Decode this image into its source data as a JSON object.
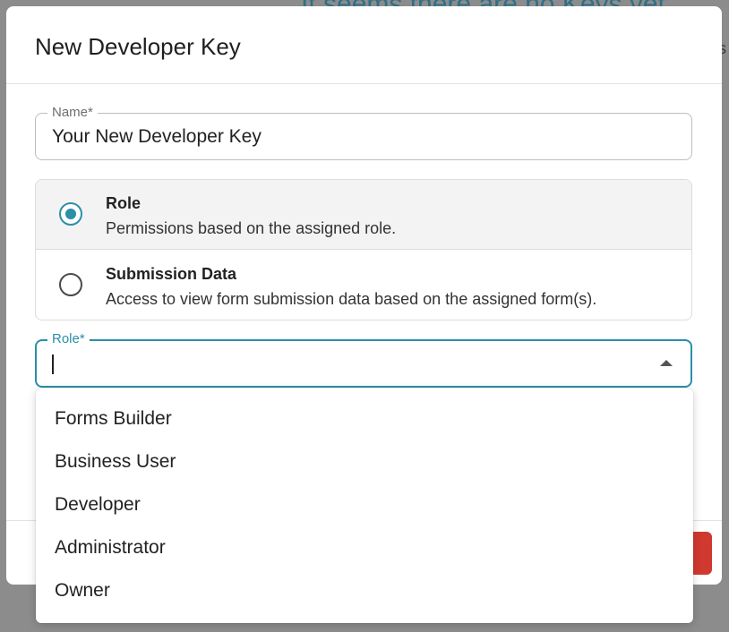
{
  "background": {
    "heading": "It seems there are no Keys yet",
    "edge_text": "s"
  },
  "modal": {
    "title": "New Developer Key",
    "name_field": {
      "label": "Name*",
      "value": "Your New Developer Key"
    },
    "access_options": [
      {
        "title": "Role",
        "description": "Permissions based on the assigned role.",
        "selected": true
      },
      {
        "title": "Submission Data",
        "description": "Access to view form submission data based on the assigned form(s).",
        "selected": false
      }
    ],
    "role_field": {
      "label": "Role*",
      "value": ""
    },
    "role_options": [
      "Forms Builder",
      "Business User",
      "Developer",
      "Administrator",
      "Owner"
    ]
  },
  "colors": {
    "accent": "#2b8fa8",
    "danger": "#d0392f"
  },
  "icons": {
    "dropdown_toggle": "triangle-up-icon"
  }
}
